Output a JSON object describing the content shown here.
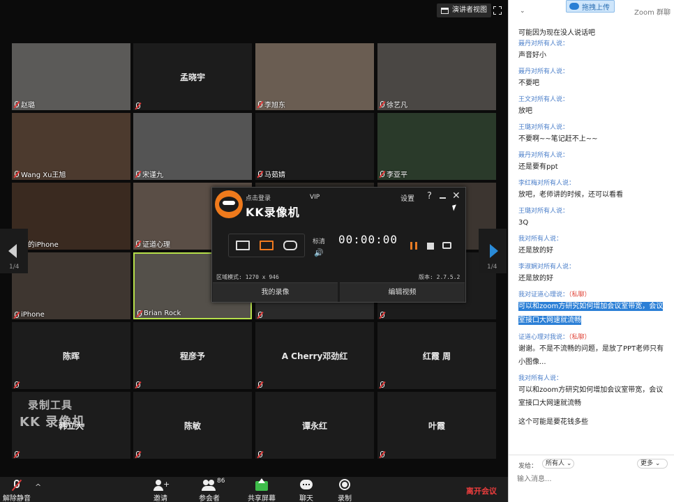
{
  "meeting": {
    "speaker_view_label": "演讲者视图",
    "page_indicator": "1/4",
    "participant_count": "86",
    "colors": {
      "active_speaker_border": "#b6e04a",
      "leave": "#ee3d3d",
      "nav_arrow": "#2a8bd8"
    },
    "tiles": [
      {
        "name": "赵璐",
        "type": "video"
      },
      {
        "name": "孟晓宇",
        "type": "name"
      },
      {
        "name": "李旭东",
        "type": "video"
      },
      {
        "name": "徐艺凡",
        "type": "video"
      },
      {
        "name": "Wang Xu王旭",
        "type": "video"
      },
      {
        "name": "宋谨九",
        "type": "video"
      },
      {
        "name": "马茹婧",
        "type": "video"
      },
      {
        "name": "李亚平",
        "type": "video"
      },
      {
        "name": "红的iPhone",
        "type": "video"
      },
      {
        "name": "证道心理",
        "type": "video"
      },
      {
        "name": "",
        "type": "video"
      },
      {
        "name": "",
        "type": "video"
      },
      {
        "name": "iPhone",
        "type": "video"
      },
      {
        "name": "Brian Rock",
        "type": "video",
        "active": true
      },
      {
        "name": "",
        "type": "video"
      },
      {
        "name": "",
        "type": "name"
      },
      {
        "name": "陈晖",
        "type": "name"
      },
      {
        "name": "程彦予",
        "type": "name"
      },
      {
        "name": "A Cherry邓劲红",
        "type": "name"
      },
      {
        "name": "红霞 周",
        "type": "name"
      },
      {
        "name": "韩立大",
        "type": "name"
      },
      {
        "name": "陈敏",
        "type": "name"
      },
      {
        "name": "谭永红",
        "type": "name"
      },
      {
        "name": "叶霞",
        "type": "name"
      }
    ],
    "watermark": {
      "line1": "录制工具",
      "line2": "KK 录像机"
    },
    "toolbar": {
      "unmute": "解除静音",
      "invite": "邀请",
      "participants": "参会者",
      "share": "共享屏幕",
      "chat": "聊天",
      "record": "录制",
      "leave": "离开会议"
    }
  },
  "recorder": {
    "login": "点击登录",
    "vip": "VIP",
    "title": "KK录像机",
    "settings": "设置",
    "help": "?",
    "close": "✕",
    "quality": "标清",
    "volume_icon": "🔊",
    "timer": "00:00:00",
    "region_info": "区域模式: 1270 x 946",
    "version": "版本: 2.7.5.2",
    "my_recordings": "我的录像",
    "edit_video": "编辑视频",
    "accent_color": "#f07a1f"
  },
  "chat": {
    "collapse": "⌄",
    "upload_label": "拖拽上传",
    "title": "Zoom 群聊",
    "messages": [
      {
        "who": "",
        "text": "可能因为现在没人说话吧"
      },
      {
        "who": "聂丹对所有人说：",
        "text": "声音好小"
      },
      {
        "who": "聂丹对所有人说：",
        "text": "不要吧"
      },
      {
        "who": "王文对所有人说：",
        "text": "放吧"
      },
      {
        "who": "王璐对所有人说：",
        "text": "不要啊~~笔记赶不上~~"
      },
      {
        "who": "聂丹对所有人说：",
        "text": "还是要有ppt"
      },
      {
        "who": "李红梅对所有人说：",
        "text": "放吧，老师讲的时候，还可以看看"
      },
      {
        "who": "王璐对所有人说：",
        "text": "3Q"
      },
      {
        "who": "我对所有人说：",
        "text": "还是放的好"
      },
      {
        "who": "李淑娴对所有人说：",
        "text": "还是放的好"
      },
      {
        "who": "我对证道心理说：",
        "pm": "（私聊）",
        "text": "可以和zoom方研究如何增加会议室带宽，会议室接口大网速就流畅",
        "highlight": true
      },
      {
        "who": "证道心理对我说：",
        "pm": "（私聊）",
        "text": "谢谢。不是不流畅的问题，是放了PPT老师只有小图像..."
      },
      {
        "who": "我对所有人说：",
        "text": "可以和zoom方研究如何增加会议室带宽，会议室接口大网速就流畅"
      },
      {
        "who": "",
        "text": "这个可能是要花钱多些"
      }
    ],
    "send_to_label": "发给：",
    "send_to_value": "所有人",
    "more_label": "更多",
    "input_placeholder": "输入消息..."
  }
}
